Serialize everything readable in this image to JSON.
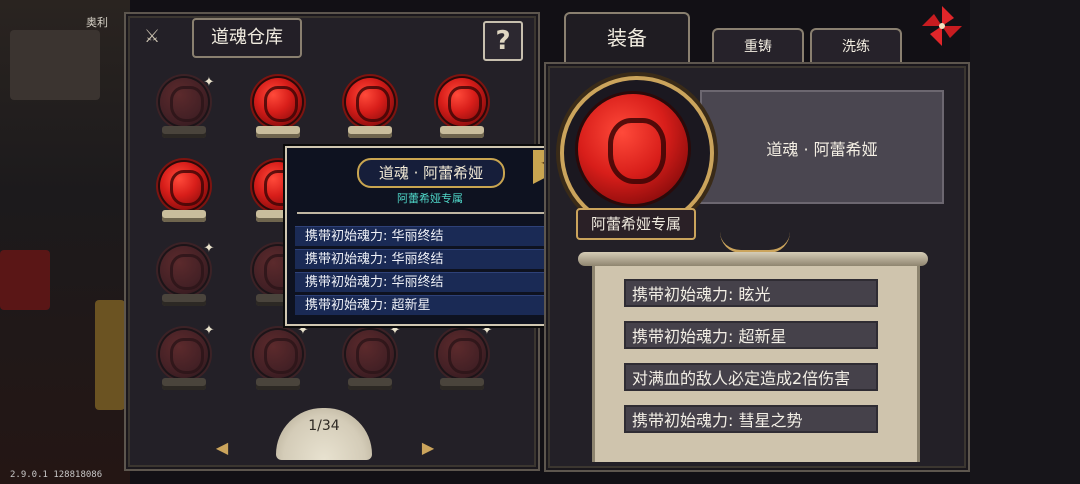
{
  "background": {
    "label": "奥利"
  },
  "storage": {
    "title": "道魂仓库",
    "help_label": "?",
    "page_indicator": "1/34",
    "prev_arrow": "◀",
    "next_arrow": "▶"
  },
  "tabs": {
    "equip": "装备",
    "reforge": "重铸",
    "refine": "洗练"
  },
  "tooltip": {
    "title": "道魂 · 阿蕾希娅",
    "subtitle": "阿蕾希娅专属",
    "bookmark": "✦",
    "rows": [
      "携带初始魂力: 华丽终结",
      "携带初始魂力: 华丽终结",
      "携带初始魂力: 华丽终结",
      "携带初始魂力: 超新星"
    ]
  },
  "equipped": {
    "name": "道魂 · 阿蕾希娅",
    "exclusive": "阿蕾希娅专属",
    "attributes": [
      "携带初始魂力: 眩光",
      "携带初始魂力: 超新星",
      "对满血的敌人必定造成2倍伤害",
      "携带初始魂力: 彗星之势"
    ]
  },
  "version": "2.9.0.1 128818086",
  "colors": {
    "accent_gold": "#cba45c",
    "orb_red": "#d81e1a",
    "tooltip_bg": "#0e1220",
    "subtitle_teal": "#4fd6c8"
  }
}
